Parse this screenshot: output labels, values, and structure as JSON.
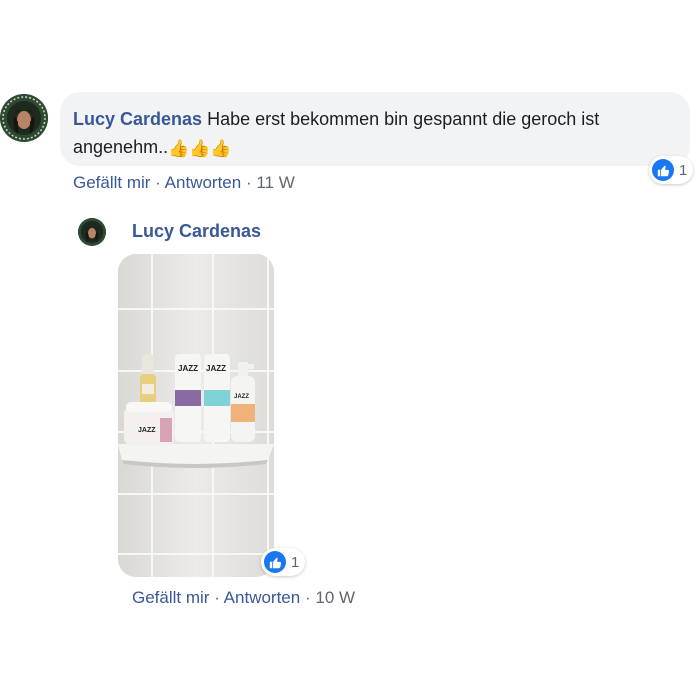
{
  "comment": {
    "author": "Lucy Cardenas",
    "text": "Habe erst bekommen bin gespannt die geroch ist angenehm..",
    "emoji": "👍👍👍",
    "reaction_icon": "like-icon",
    "reaction_count": "1",
    "actions": {
      "like": "Gefällt mir",
      "reply": "Antworten",
      "time": "11 W",
      "separator": "·"
    }
  },
  "reply": {
    "author": "Lucy Cardenas",
    "photo_brand_text": [
      "JAZZ",
      "JAZZ",
      "JAZZ",
      "JAZZ"
    ],
    "reaction_icon": "like-icon",
    "reaction_count": "1",
    "actions": {
      "like": "Gefällt mir",
      "reply": "Antworten",
      "time": "10 W",
      "separator": "·"
    }
  },
  "colors": {
    "link": "#385898",
    "meta": "#606770",
    "bubble": "#f2f3f5",
    "like": "#1877f2"
  }
}
